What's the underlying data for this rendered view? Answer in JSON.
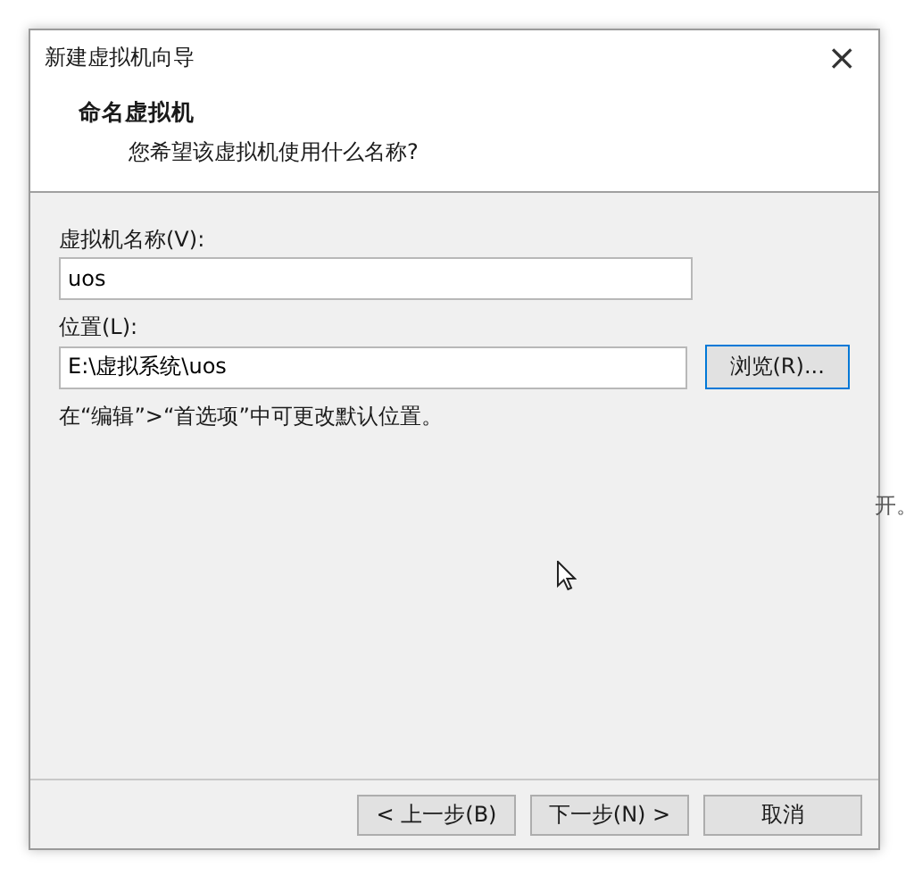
{
  "background_text": "开。",
  "window": {
    "title": "新建虚拟机向导",
    "close": "×"
  },
  "header": {
    "title": "命名虚拟机",
    "subtitle": "您希望该虚拟机使用什么名称?"
  },
  "fields": [
    {
      "label": "虚拟机名称(V):",
      "value": "uos"
    },
    {
      "label": "位置(L):",
      "value": "E:\\虚拟系统\\uos",
      "button": "浏览(R)..."
    }
  ],
  "hint": "在“编辑”>“首选项”中可更改默认位置。",
  "buttons": [
    {
      "label": "< 上一步(B)",
      "default": false
    },
    {
      "label": "下一步(N) >",
      "default": false
    },
    {
      "label": "取消",
      "default": false
    }
  ]
}
